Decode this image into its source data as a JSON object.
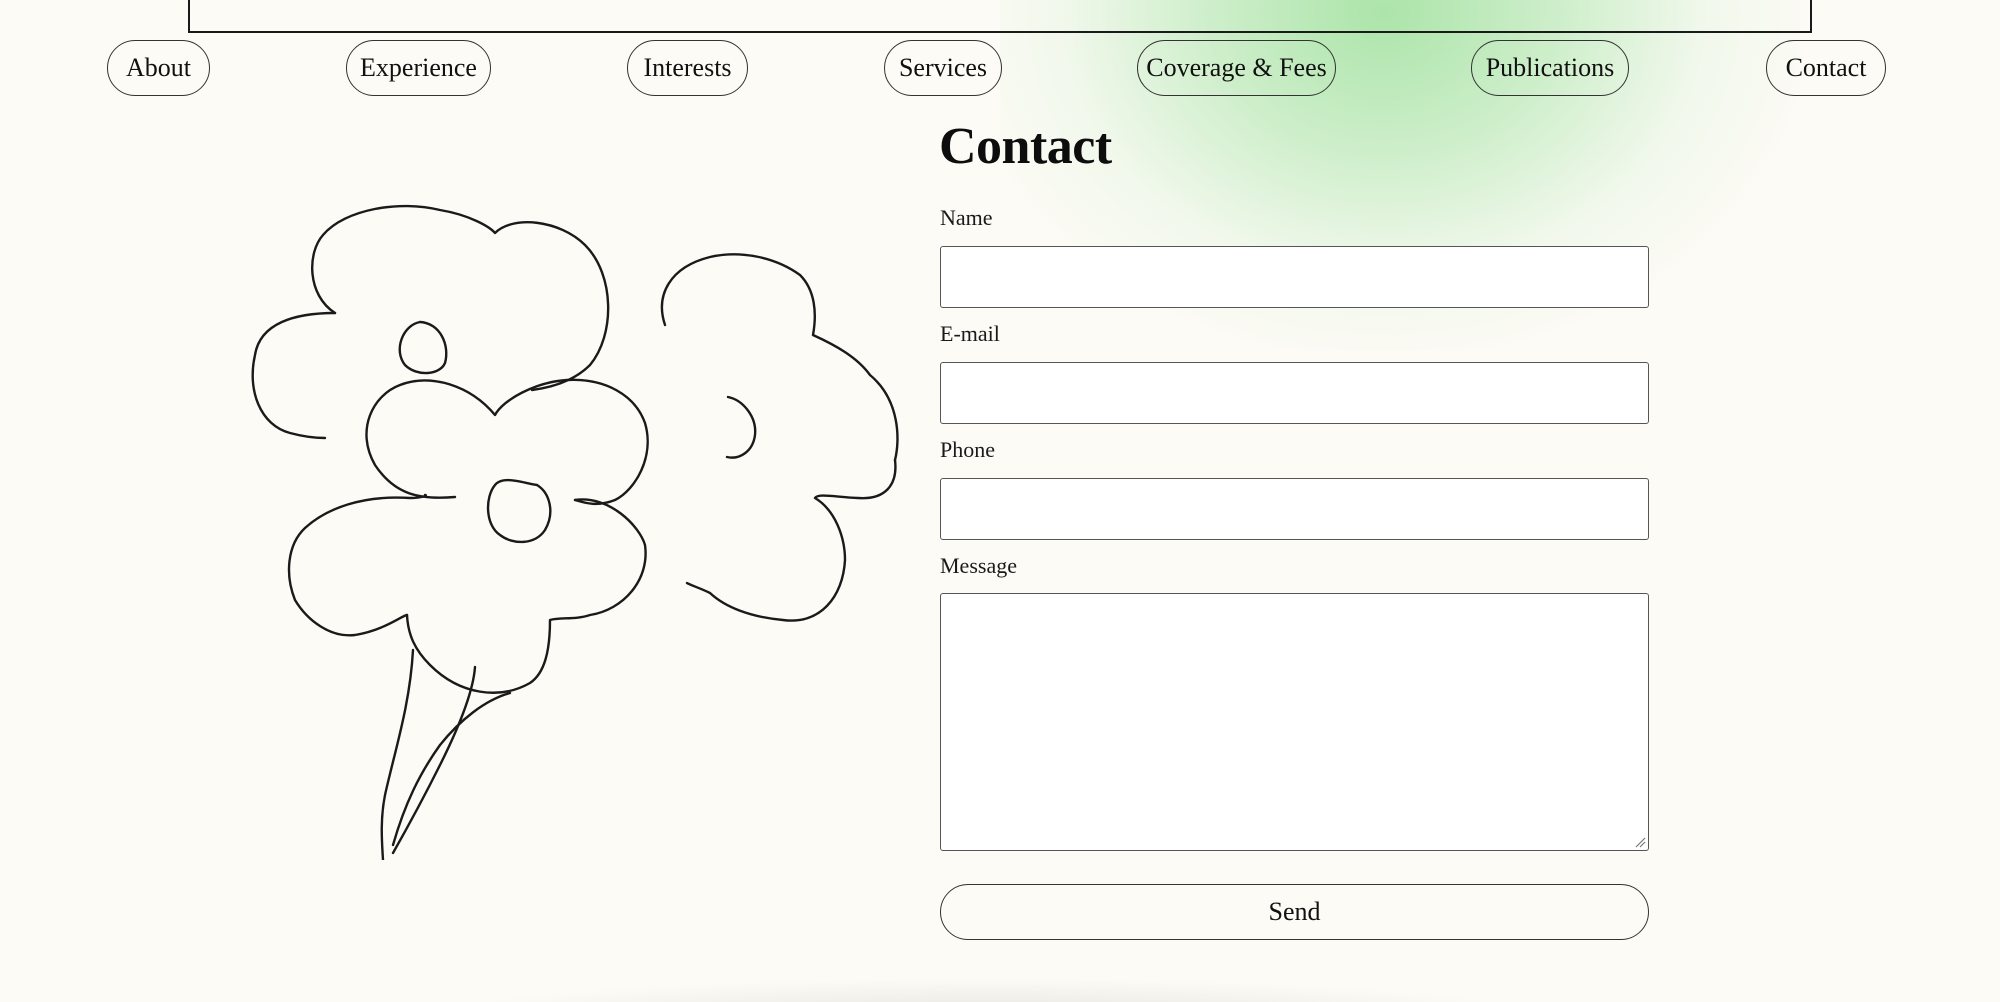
{
  "nav": {
    "items": [
      {
        "label": "About"
      },
      {
        "label": "Experience"
      },
      {
        "label": "Interests"
      },
      {
        "label": "Services"
      },
      {
        "label": "Coverage & Fees"
      },
      {
        "label": "Publications"
      },
      {
        "label": "Contact"
      }
    ]
  },
  "contact": {
    "title": "Contact",
    "fields": {
      "name": {
        "label": "Name",
        "value": ""
      },
      "email": {
        "label": "E-mail",
        "value": ""
      },
      "phone": {
        "label": "Phone",
        "value": ""
      },
      "message": {
        "label": "Message",
        "value": ""
      }
    },
    "send_label": "Send"
  },
  "icons": {
    "illustration": "flower-bouquet-illustration"
  },
  "colors": {
    "background": "#fdfbf6",
    "accent_glow": "#8cdc8c",
    "ink": "#1a1a1a"
  }
}
